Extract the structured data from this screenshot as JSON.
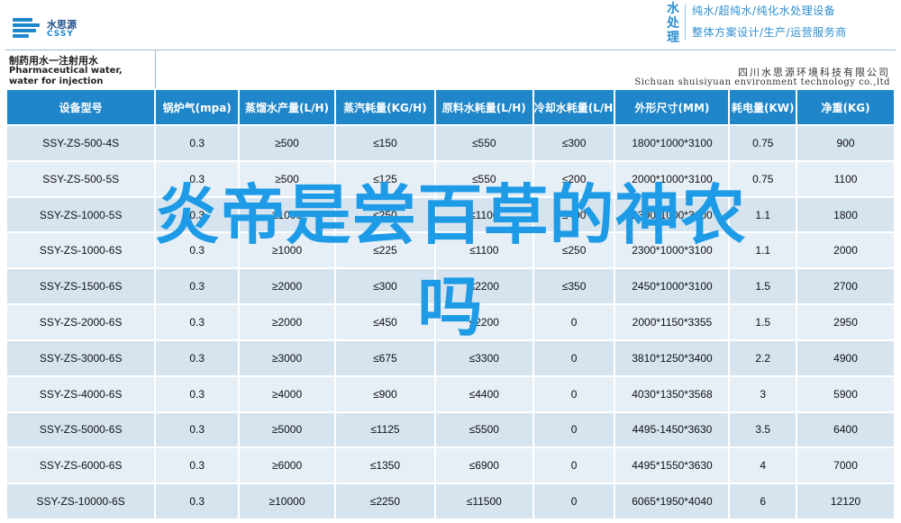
{
  "header": {
    "logo_name": "水思源",
    "logo_en": "CSSY",
    "brand_short": "水处理",
    "brand_line1": "纯水/超纯水/纯化水处理设备",
    "brand_line2": "整体方案设计/生产/运营服务商"
  },
  "title": {
    "cn": "制药用水一注射用水",
    "en": "Pharmaceutical water, water for injection",
    "company_cn": "四川水思源环境科技有限公司",
    "company_en": "Sichuan shuisiyuan environment technology co.,ltd"
  },
  "table": {
    "headers": [
      "设备型号",
      "锅炉气(mpa)",
      "蒸馏水产量(L/H)",
      "蒸汽耗量(KG/H)",
      "原料水耗量(L/H)",
      "冷却水耗量(L/H)",
      "外形尺寸(MM)",
      "耗电量(KW)",
      "净重(KG)"
    ],
    "rows": [
      [
        "SSY-ZS-500-4S",
        "0.3",
        "≥500",
        "≤150",
        "≤550",
        "≤300",
        "1800*1000*3100",
        "0.75",
        "900"
      ],
      [
        "SSY-ZS-500-5S",
        "0.3",
        "≥500",
        "≤125",
        "≤550",
        "≤200",
        "2000*1000*3100",
        "0.75",
        "1100"
      ],
      [
        "SSY-ZS-1000-5S",
        "0.3",
        "≥1000",
        "≤250",
        "≤1100",
        "≤400",
        "2300*1000*3100",
        "1.1",
        "1800"
      ],
      [
        "SSY-ZS-1000-6S",
        "0.3",
        "≥1000",
        "≤225",
        "≤1100",
        "≤250",
        "2300*1000*3100",
        "1.1",
        "2000"
      ],
      [
        "SSY-ZS-1500-6S",
        "0.3",
        "≥2000",
        "≤300",
        "≤2200",
        "≤350",
        "2450*1000*3100",
        "1.5",
        "2700"
      ],
      [
        "SSY-ZS-2000-6S",
        "0.3",
        "≥2000",
        "≤450",
        "≤2200",
        "0",
        "2000*1150*3355",
        "1.5",
        "2950"
      ],
      [
        "SSY-ZS-3000-6S",
        "0.3",
        "≥3000",
        "≤675",
        "≤3300",
        "0",
        "3810*1250*3400",
        "2.2",
        "4900"
      ],
      [
        "SSY-ZS-4000-6S",
        "0.3",
        "≥4000",
        "≤900",
        "≤4400",
        "0",
        "4030*1350*3568",
        "3",
        "5900"
      ],
      [
        "SSY-ZS-5000-6S",
        "0.3",
        "≥5000",
        "≤1125",
        "≤5500",
        "0",
        "4495-1450*3630",
        "3.5",
        "6400"
      ],
      [
        "SSY-ZS-6000-6S",
        "0.3",
        "≥6000",
        "≤1350",
        "≤6900",
        "0",
        "4495*1550*3630",
        "4",
        "7000"
      ],
      [
        "SSY-ZS-10000-6S",
        "0.3",
        "≥10000",
        "≤2250",
        "≤11500",
        "0",
        "6065*1950*4040",
        "6",
        "12120"
      ]
    ]
  },
  "overlay": {
    "line1": "炎帝是尝百草的神农",
    "line2": "吗"
  },
  "colors": {
    "header_blue": "#1f86c9",
    "row_odd": "#d6e4f0",
    "row_even": "#e6eef6",
    "overlay_text": "#1e9be6"
  }
}
